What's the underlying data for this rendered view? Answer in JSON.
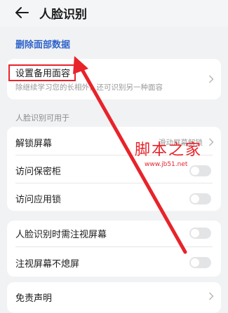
{
  "header": {
    "title": "人脸识别",
    "back_icon": "back-arrow-icon"
  },
  "delete_link": "删除面部数据",
  "alt_face": {
    "label": "设置备用面容",
    "subtitle": "除继续学习您的长相外，还可识别另一种面容"
  },
  "section_title": "人脸识别可用于",
  "unlock": {
    "label": "解锁屏幕",
    "value": "滑动屏幕解锁"
  },
  "vault": {
    "label": "访问保密柜",
    "enabled": false
  },
  "applock": {
    "label": "访问应用锁",
    "enabled": false
  },
  "attention": {
    "label": "人脸识别时需注视屏幕",
    "enabled": false
  },
  "stay_on": {
    "label": "注视屏幕不熄屏",
    "enabled": false
  },
  "disclaimer": {
    "label": "免责声明"
  },
  "watermark": {
    "name": "脚本之家",
    "url": "www.jb51.net"
  },
  "colors": {
    "accent": "#2f63c9",
    "annotation": "#e8232a",
    "background": "#f1f2f4"
  }
}
